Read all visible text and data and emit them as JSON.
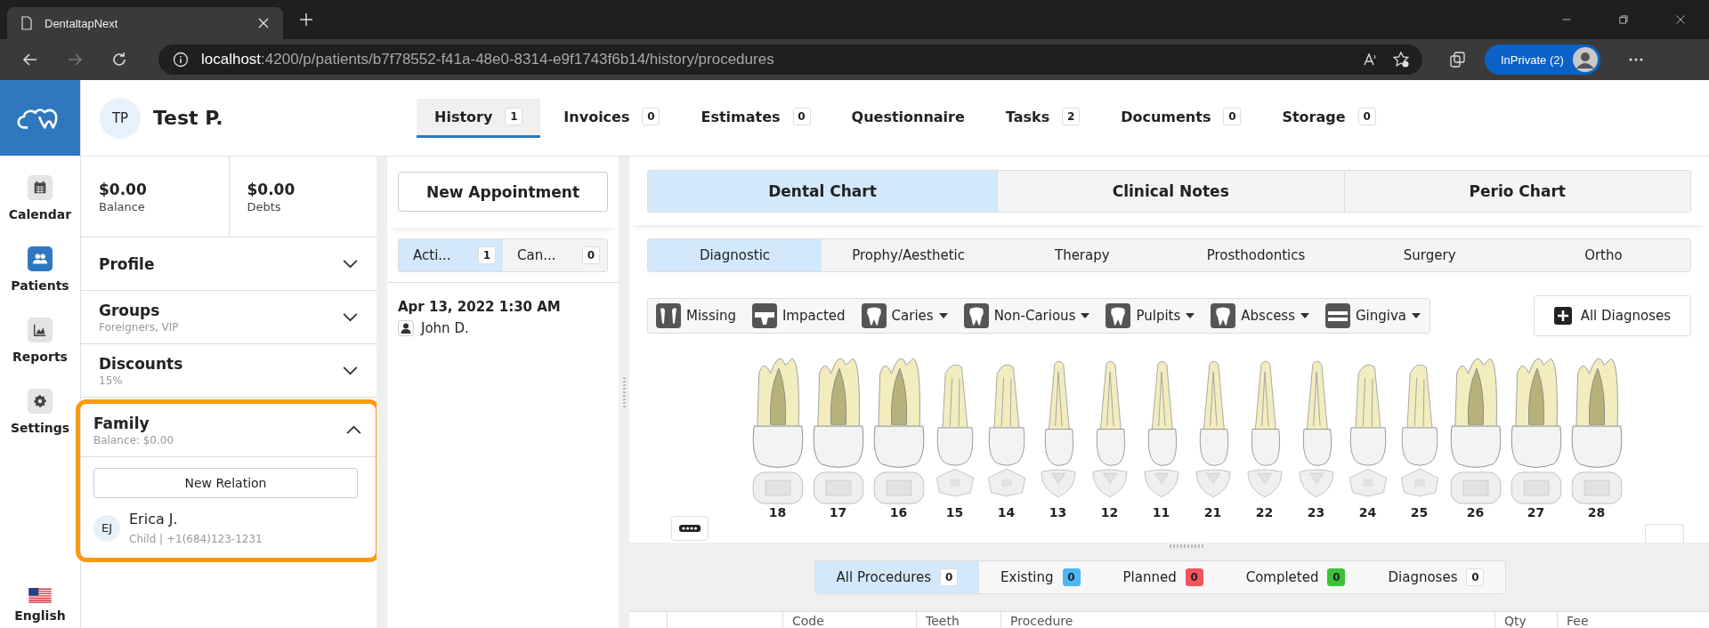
{
  "browser": {
    "tab_title": "DentaltapNext",
    "url_host": "localhost",
    "url_path": ":4200/p/patients/b7f78552-f41a-48e0-8314-e9f1743f6b14/history/procedures",
    "profile_label": "InPrivate (2)"
  },
  "nav": {
    "items": [
      {
        "label": "Calendar",
        "selected": false
      },
      {
        "label": "Patients",
        "selected": true
      },
      {
        "label": "Reports",
        "selected": false
      },
      {
        "label": "Settings",
        "selected": false
      }
    ],
    "language": "English"
  },
  "patient": {
    "initials": "TP",
    "name": "Test P."
  },
  "tabs": [
    {
      "label": "History",
      "count": "1",
      "selected": true
    },
    {
      "label": "Invoices",
      "count": "0",
      "selected": false
    },
    {
      "label": "Estimates",
      "count": "0",
      "selected": false
    },
    {
      "label": "Questionnaire",
      "selected": false
    },
    {
      "label": "Tasks",
      "count": "2",
      "selected": false
    },
    {
      "label": "Documents",
      "count": "0",
      "selected": false
    },
    {
      "label": "Storage",
      "count": "0",
      "selected": false
    }
  ],
  "summary": [
    {
      "amount": "$0.00",
      "label": "Balance"
    },
    {
      "amount": "$0.00",
      "label": "Debts"
    }
  ],
  "sections": [
    {
      "title": "Profile",
      "expanded": false
    },
    {
      "title": "Groups",
      "subtitle": "Foreigners, VIP",
      "expanded": false
    },
    {
      "title": "Discounts",
      "subtitle": "15%",
      "expanded": false
    }
  ],
  "family": {
    "title": "Family",
    "subtitle": "Balance: $0.00",
    "expanded": true,
    "new_button": "New Relation",
    "members": [
      {
        "initials": "EJ",
        "name": "Erica J.",
        "detail": "Child | +1(684)123-1231"
      }
    ]
  },
  "appointments": {
    "new_button": "New Appointment",
    "filters": [
      {
        "label": "Acti...",
        "count": "1",
        "selected": true
      },
      {
        "label": "Can...",
        "count": "0",
        "selected": false
      }
    ],
    "items": [
      {
        "datetime": "Apr 13, 2022 1:30 AM",
        "doctor": "John D."
      }
    ]
  },
  "chart_tabs": [
    {
      "label": "Dental Chart",
      "selected": true
    },
    {
      "label": "Clinical Notes",
      "selected": false
    },
    {
      "label": "Perio Chart",
      "selected": false
    }
  ],
  "sub_tabs": [
    {
      "label": "Diagnostic",
      "selected": true
    },
    {
      "label": "Prophy/Aesthetic",
      "selected": false
    },
    {
      "label": "Therapy",
      "selected": false
    },
    {
      "label": "Prosthodontics",
      "selected": false
    },
    {
      "label": "Surgery",
      "selected": false
    },
    {
      "label": "Ortho",
      "selected": false
    }
  ],
  "diagnoses": [
    {
      "label": "Missing",
      "dropdown": false
    },
    {
      "label": "Impacted",
      "dropdown": false
    },
    {
      "label": "Caries",
      "dropdown": true
    },
    {
      "label": "Non-Carious",
      "dropdown": true
    },
    {
      "label": "Pulpits",
      "dropdown": true
    },
    {
      "label": "Abscess",
      "dropdown": true
    },
    {
      "label": "Gingiva",
      "dropdown": true
    }
  ],
  "all_diagnoses": "All Diagnoses",
  "teeth": [
    {
      "number": "18",
      "kind": "molar"
    },
    {
      "number": "17",
      "kind": "molar"
    },
    {
      "number": "16",
      "kind": "molar"
    },
    {
      "number": "15",
      "kind": "premolar"
    },
    {
      "number": "14",
      "kind": "premolar"
    },
    {
      "number": "13",
      "kind": "front"
    },
    {
      "number": "12",
      "kind": "front"
    },
    {
      "number": "11",
      "kind": "front"
    },
    {
      "number": "21",
      "kind": "front"
    },
    {
      "number": "22",
      "kind": "front"
    },
    {
      "number": "23",
      "kind": "front"
    },
    {
      "number": "24",
      "kind": "premolar"
    },
    {
      "number": "25",
      "kind": "premolar"
    },
    {
      "number": "26",
      "kind": "molar"
    },
    {
      "number": "27",
      "kind": "molar"
    },
    {
      "number": "28",
      "kind": "molar"
    }
  ],
  "procedure_filters": [
    {
      "label": "All Procedures",
      "count": "0",
      "selected": true
    },
    {
      "label": "Existing",
      "count": "0",
      "color": "#4db6f5",
      "selected": false
    },
    {
      "label": "Planned",
      "count": "0",
      "color": "#f2545b",
      "selected": false
    },
    {
      "label": "Completed",
      "count": "0",
      "color": "#3cc13b",
      "selected": false
    },
    {
      "label": "Diagnoses",
      "count": "0",
      "selected": false
    }
  ],
  "table": {
    "columns": [
      "Code",
      "Teeth",
      "Procedure",
      "Qty",
      "Fee"
    ]
  }
}
